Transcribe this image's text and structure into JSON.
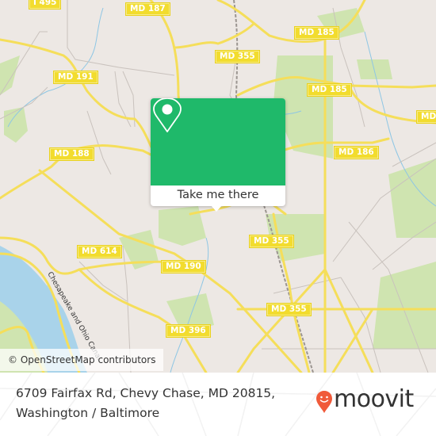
{
  "map": {
    "road_labels": [
      {
        "text": "I 495"
      },
      {
        "text": "MD 187"
      },
      {
        "text": "MD 185"
      },
      {
        "text": "MD 355"
      },
      {
        "text": "MD 191"
      },
      {
        "text": "MD 185"
      },
      {
        "text": "MD 188"
      },
      {
        "text": "MD 186"
      },
      {
        "text": "MD"
      },
      {
        "text": "MD 355"
      },
      {
        "text": "MD 614"
      },
      {
        "text": "MD 190"
      },
      {
        "text": "MD 355"
      },
      {
        "text": "MD 396"
      }
    ],
    "waterway_label": "Chesapeake and Ohio Canal",
    "attribution": "© OpenStreetMap contributors",
    "colors": {
      "land": "#ede8e4",
      "park": "#c8e1a5",
      "water": "#a9d3ea",
      "road": "#f5de5a",
      "shield": "#f2dc2e"
    }
  },
  "popup": {
    "icon": "map-pin-icon",
    "button_label": "Take me there",
    "color": "#1fb96a"
  },
  "footer": {
    "address_line1": "6709 Fairfax Rd, Chevy Chase, MD 20815,",
    "address_line2": "Washington / Baltimore",
    "brand": "moovit",
    "brand_color": "#f05a3a"
  }
}
